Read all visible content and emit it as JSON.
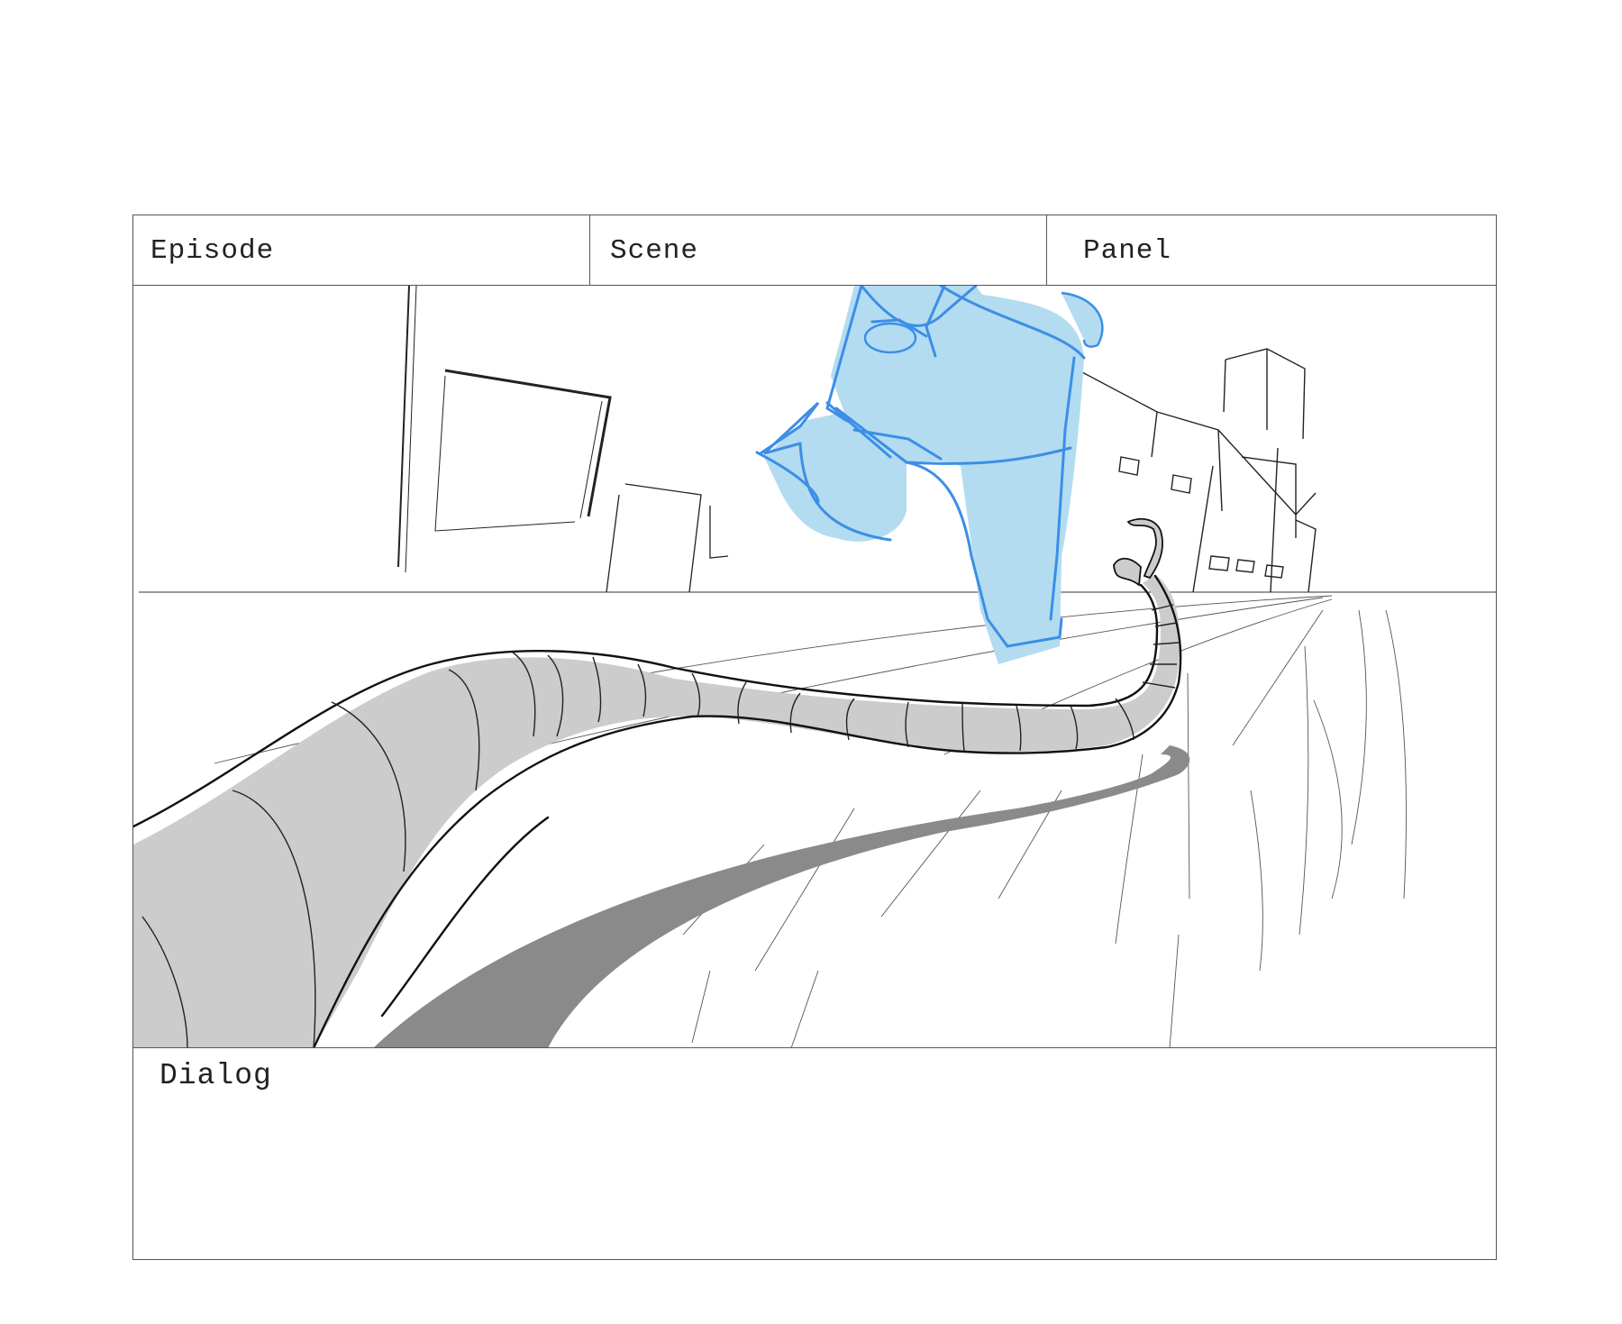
{
  "header": {
    "episode_label": "Episode",
    "scene_label": "Scene",
    "panel_label": "Panel"
  },
  "dialog": {
    "label": "Dialog"
  },
  "colors": {
    "character_fill": "#b3dcf0",
    "character_line": "#3c8ee6",
    "tail_fill": "#cccccc",
    "shadow": "#8a8a8a",
    "ink": "#111111"
  },
  "icons": {
    "illustration": "storyboard-sketch"
  }
}
